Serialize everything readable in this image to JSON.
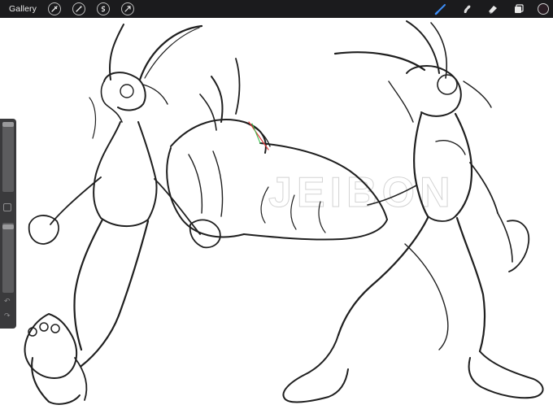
{
  "topbar": {
    "gallery_label": "Gallery",
    "tools_left": [
      "wrench-icon",
      "magic-wand-icon",
      "selection-icon",
      "transform-icon"
    ],
    "tools_right": [
      "brush-icon",
      "smudge-icon",
      "eraser-icon",
      "layers-icon"
    ],
    "active_tool": "brush-icon",
    "accent_color": "#3d8df5",
    "current_color": "#2a1d24"
  },
  "sidebar": {
    "brush_size_level": 0.98,
    "opacity_level": 0.94,
    "buttons": [
      "modify-button",
      "undo-button",
      "redo-button"
    ]
  },
  "canvas": {
    "watermark": "JEIBON",
    "content": "sketch"
  }
}
